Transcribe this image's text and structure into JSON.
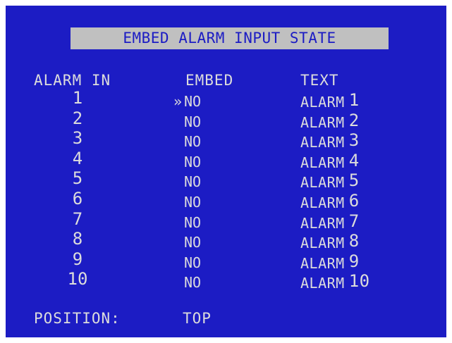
{
  "screen": {
    "title": "EMBED ALARM INPUT STATE",
    "colors": {
      "background": "#1c1cc4",
      "text": "#dcdcdc",
      "title_bg": "#c0c0c0",
      "title_text": "#1c1cc4"
    }
  },
  "table": {
    "headers": {
      "alarm_in": "ALARM IN",
      "embed": "EMBED",
      "text": "TEXT"
    },
    "selection_marker": "»",
    "selected_row": 0,
    "rows": [
      {
        "alarm_in": "1",
        "embed": "NO",
        "text_label": "ALARM",
        "text_num": "1"
      },
      {
        "alarm_in": "2",
        "embed": "NO",
        "text_label": "ALARM",
        "text_num": "2"
      },
      {
        "alarm_in": "3",
        "embed": "NO",
        "text_label": "ALARM",
        "text_num": "3"
      },
      {
        "alarm_in": "4",
        "embed": "NO",
        "text_label": "ALARM",
        "text_num": "4"
      },
      {
        "alarm_in": "5",
        "embed": "NO",
        "text_label": "ALARM",
        "text_num": "5"
      },
      {
        "alarm_in": "6",
        "embed": "NO",
        "text_label": "ALARM",
        "text_num": "6"
      },
      {
        "alarm_in": "7",
        "embed": "NO",
        "text_label": "ALARM",
        "text_num": "7"
      },
      {
        "alarm_in": "8",
        "embed": "NO",
        "text_label": "ALARM",
        "text_num": "8"
      },
      {
        "alarm_in": "9",
        "embed": "NO",
        "text_label": "ALARM",
        "text_num": "9"
      },
      {
        "alarm_in": "10",
        "embed": "NO",
        "text_label": "ALARM",
        "text_num": "10"
      }
    ]
  },
  "position": {
    "label": "POSITION:",
    "value": "TOP"
  }
}
